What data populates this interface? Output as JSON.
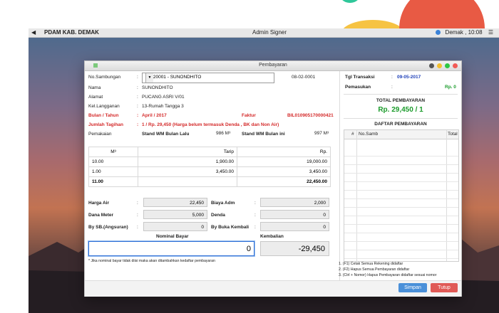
{
  "menubar": {
    "app_name": "PDAM KAB. DEMAK",
    "title": "Admin Signer",
    "user": "Demak",
    "time": "10:08"
  },
  "window": {
    "title": "Pembayaran"
  },
  "form": {
    "no_sambungan_label": "No.Sambungan",
    "no_sambungan_value": "08020001 - SUNONDHITO",
    "code": "08-02-0001",
    "nama_label": "Nama",
    "nama_value": "SUNONDHITO",
    "alamat_label": "Alamat",
    "alamat_value": "PUCANG ASRI V/01",
    "kel_label": "Kel.Langganan",
    "kel_value": "13-Rumah Tangga 3",
    "bulan_label": "Bulan / Tahun",
    "bulan_value": "April / 2017",
    "faktur_label": "Faktur",
    "faktur_value": "BIL010905170000421",
    "jumlah_label": "Jumlah Tagihan",
    "jumlah_value": "1 / Rp. 29,450 (Harga belum termasuk Denda , BK dan Non Air)",
    "pemakaian_label": "Pemakaian",
    "stand_lalu_label": "Stand WM Bulan Lalu",
    "stand_lalu_value": "986 M³",
    "stand_ini_label": "Stand WM Bulan ini",
    "stand_ini_value": "997 M³",
    "colon": ":"
  },
  "tarip_table": {
    "headers": [
      "M³",
      "Tarip",
      "Rp."
    ],
    "rows": [
      [
        "10.00",
        "1,900.00",
        "19,000.00"
      ],
      [
        "1.00",
        "3,450.00",
        "3,450.00"
      ]
    ],
    "total": [
      "11.00",
      "",
      "22,450.00"
    ]
  },
  "charges": {
    "harga_air_label": "Harga Air",
    "harga_air_value": "22,450",
    "biaya_adm_label": "Biaya Adm",
    "biaya_adm_value": "2,000",
    "dana_meter_label": "Dana Meter",
    "dana_meter_value": "5,000",
    "denda_label": "Denda",
    "denda_value": "0",
    "sb_label": "By SB.(Angsuran)",
    "sb_value": "0",
    "buka_label": "By Buka Kembali",
    "buka_value": "0"
  },
  "payment": {
    "nominal_label": "Nominal Bayar",
    "nominal_value": "0",
    "kembalian_label": "Kembalian",
    "kembalian_value": "-29,450",
    "footnote": "* Jika nominal bayar tidak diisi maka akan ditambahkan kedaftar pembayaran"
  },
  "right": {
    "tgl_label": "Tgl Transaksi",
    "tgl_value": "09-05-2017",
    "pemasukan_label": "Pemasukan",
    "pemasukan_value": "Rp. 0",
    "total_label": "TOTAL PEMBAYARAN",
    "total_value": "Rp. 29,450 / 1",
    "daftar_label": "DAFTAR PEMBAYARAN",
    "columns": [
      "#",
      "No.Samb",
      "Total"
    ],
    "notes": [
      "1. (F1) Cetak Semua Rekening didaftar",
      "2. (F2) Hapus Semua Pembayaran didaftar",
      "3. (Ctrl + Nomor) Hapus Pembayaran didaftar sesuai nomor"
    ]
  },
  "buttons": {
    "save": "Simpan",
    "close": "Tutup"
  },
  "colors": {
    "accent_red": "#d42a2a",
    "accent_green": "#1b9b2b",
    "accent_blue": "#1d3fb8",
    "save_button": "#4a90d9",
    "close_button": "#e05a56"
  }
}
